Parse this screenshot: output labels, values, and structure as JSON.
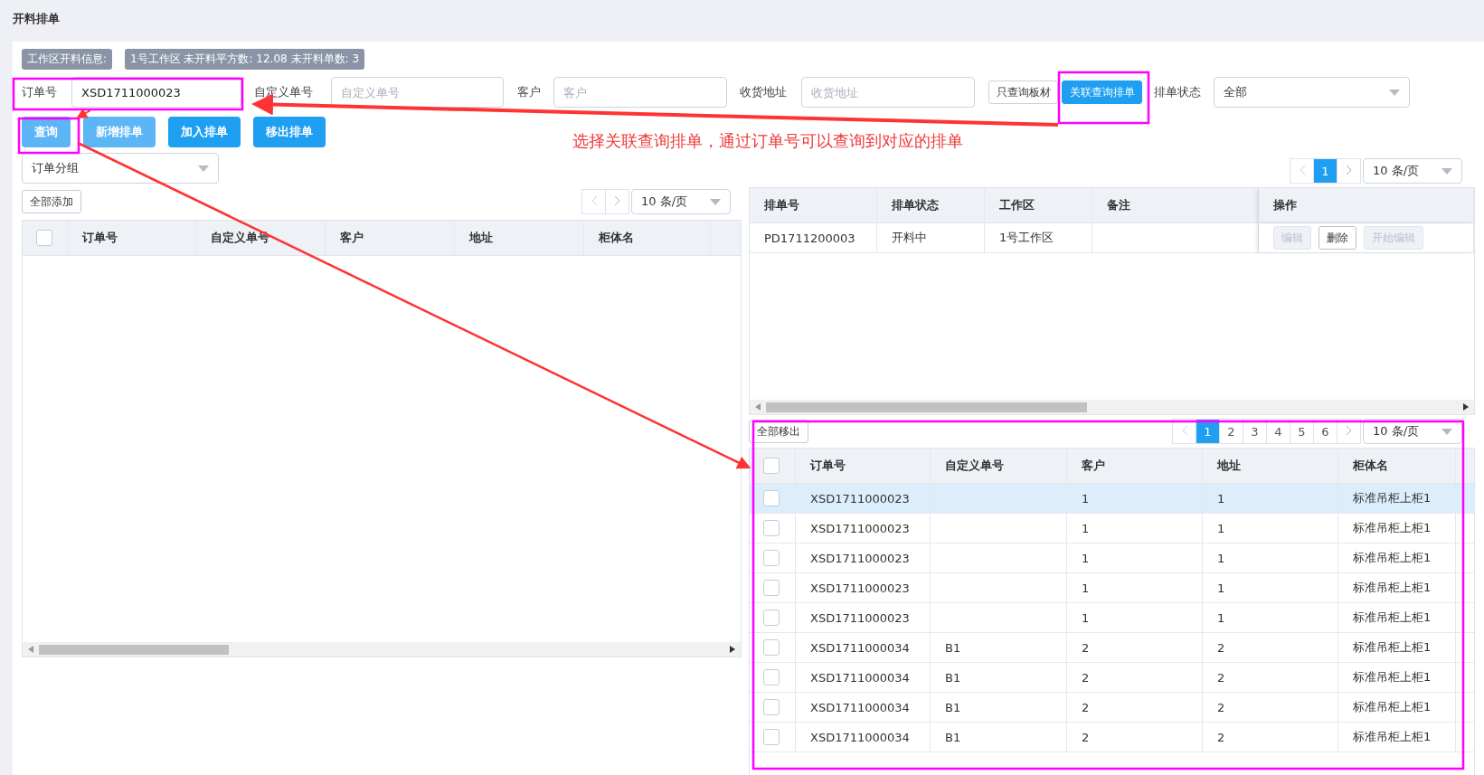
{
  "page_title": "开料排单",
  "info_tags": [
    "工作区开料信息:",
    "1号工作区 未开料平方数: 12.08 未开料单数: 3"
  ],
  "filters": [
    {
      "label": "订单号",
      "value": "XSD1711000023"
    },
    {
      "label": "自定义单号",
      "placeholder": "自定义单号"
    },
    {
      "label": "客户",
      "placeholder": "客户"
    },
    {
      "label": "收货地址",
      "placeholder": "收货地址"
    }
  ],
  "mode_toggle": [
    {
      "label": "只查询板材",
      "selected": false
    },
    {
      "label": "关联查询排单",
      "selected": true
    }
  ],
  "status_filter": {
    "label": "排单状态",
    "value": "全部"
  },
  "actions": [
    {
      "label": "查询",
      "light": true
    },
    {
      "label": "新增排单",
      "light": true
    },
    {
      "label": "加入排单",
      "light": false
    },
    {
      "label": "移出排单",
      "light": false
    }
  ],
  "annotation": {
    "text": "选择关联查询排单，通过订单号可以查询到对应的排单"
  },
  "left_panel": {
    "group_select": "订单分组",
    "add_all": "全部添加",
    "page_size": "10 条/页",
    "table": {
      "header_checked": false,
      "columns": [
        "订单号",
        "自定义单号",
        "客户",
        "地址",
        "柜体名"
      ]
    }
  },
  "schedule_panel": {
    "pages": [
      {
        "label": "1",
        "selected": true
      }
    ],
    "page_size": "10 条/页",
    "table": {
      "columns": [
        "排单号",
        "排单状态",
        "工作区",
        "备注",
        "操作"
      ],
      "rows": [
        {
          "cells": [
            "PD1711200003",
            "开料中",
            "1号工作区",
            ""
          ],
          "ops": [
            {
              "label": "编辑",
              "disabled": true
            },
            {
              "label": "删除",
              "disabled": false
            },
            {
              "label": "开始编辑",
              "disabled": true
            }
          ]
        }
      ]
    }
  },
  "bottom_panel": {
    "remove_all": "全部移出",
    "pages": [
      {
        "label": "1",
        "selected": true
      },
      {
        "label": "2",
        "selected": false
      },
      {
        "label": "3",
        "selected": false
      },
      {
        "label": "4",
        "selected": false
      },
      {
        "label": "5",
        "selected": false
      },
      {
        "label": "6",
        "selected": false
      }
    ],
    "page_size": "10 条/页",
    "table": {
      "header_checked": false,
      "columns": [
        "订单号",
        "自定义单号",
        "客户",
        "地址",
        "柜体名"
      ],
      "rows": [
        {
          "selected": true,
          "checked": false,
          "cells": [
            "XSD1711000023",
            "",
            "1",
            "1",
            "标准吊柜上柜1"
          ]
        },
        {
          "selected": false,
          "checked": false,
          "cells": [
            "XSD1711000023",
            "",
            "1",
            "1",
            "标准吊柜上柜1"
          ]
        },
        {
          "selected": false,
          "checked": false,
          "cells": [
            "XSD1711000023",
            "",
            "1",
            "1",
            "标准吊柜上柜1"
          ]
        },
        {
          "selected": false,
          "checked": false,
          "cells": [
            "XSD1711000023",
            "",
            "1",
            "1",
            "标准吊柜上柜1"
          ]
        },
        {
          "selected": false,
          "checked": false,
          "cells": [
            "XSD1711000023",
            "",
            "1",
            "1",
            "标准吊柜上柜1"
          ]
        },
        {
          "selected": false,
          "checked": false,
          "cells": [
            "XSD1711000034",
            "B1",
            "2",
            "2",
            "标准吊柜上柜1"
          ]
        },
        {
          "selected": false,
          "checked": false,
          "cells": [
            "XSD1711000034",
            "B1",
            "2",
            "2",
            "标准吊柜上柜1"
          ]
        },
        {
          "selected": false,
          "checked": false,
          "cells": [
            "XSD1711000034",
            "B1",
            "2",
            "2",
            "标准吊柜上柜1"
          ]
        },
        {
          "selected": false,
          "checked": false,
          "cells": [
            "XSD1711000034",
            "B1",
            "2",
            "2",
            "标准吊柜上柜1"
          ]
        }
      ]
    }
  }
}
